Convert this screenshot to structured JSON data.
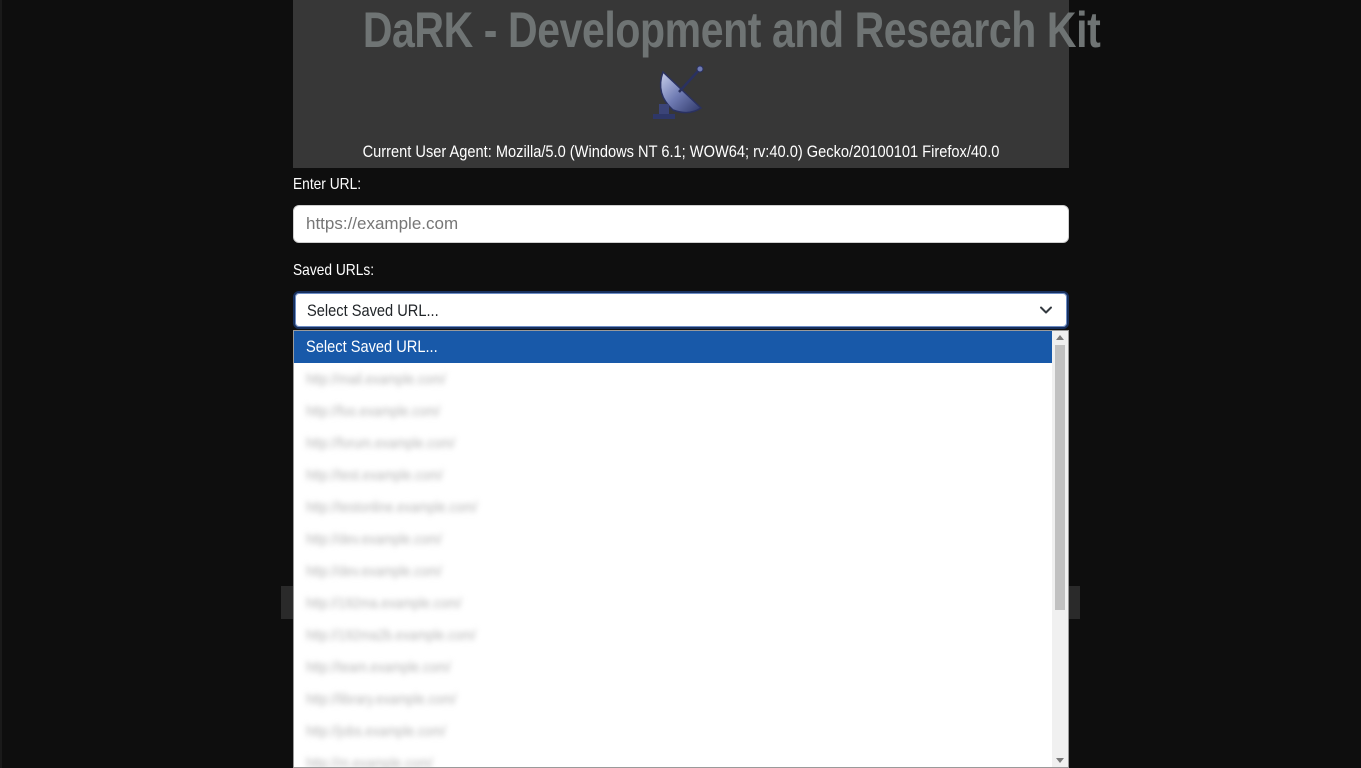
{
  "header": {
    "title": "DaRK - Development and Research Kit",
    "user_agent": "Current User Agent: Mozilla/5.0 (Windows NT 6.1; WOW64; rv:40.0) Gecko/20100101 Firefox/40.0",
    "icon": "satellite-dish-icon"
  },
  "url_field": {
    "label": "Enter URL:",
    "placeholder": "https://example.com",
    "value": ""
  },
  "saved_urls": {
    "label": "Saved URLs:",
    "selected": "Select Saved URL...",
    "options": [
      "Select Saved URL...",
      "http://mail.example.com/",
      "http://foo.example.com/",
      "http://forum.example.com/",
      "http://test.example.com/",
      "http://testonline.example.com/",
      "http://dev.example.com/",
      "http://dev.example.com/",
      "http://192ma.example.com/",
      "http://192ma2b.example.com/",
      "http://team.example.com/",
      "http://library.example.com/",
      "http://jobs.example.com/",
      "http://m.example.com/"
    ]
  },
  "colors": {
    "page_bg": "#0e0e0e",
    "header_bg": "#373737",
    "title_color": "#6f7474",
    "option_highlight": "#1859a9"
  }
}
